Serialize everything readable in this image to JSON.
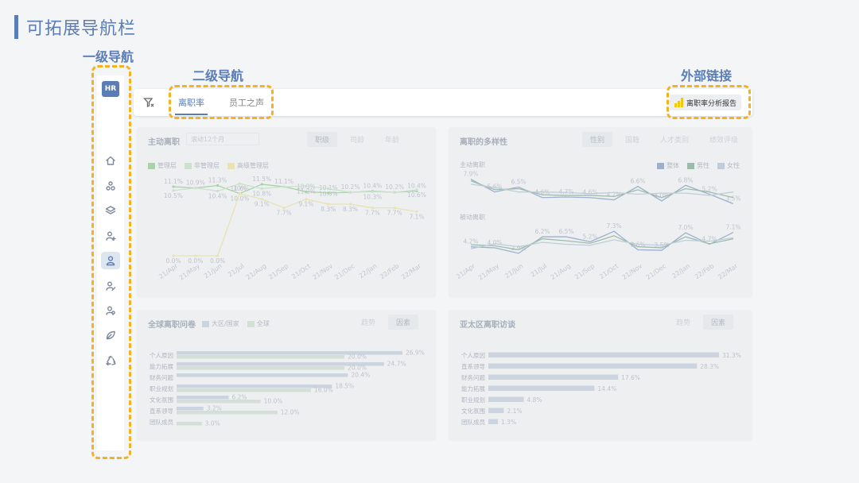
{
  "slide": {
    "title": "可拓展导航栏"
  },
  "annotations": {
    "primary_nav": "一级导航",
    "secondary_nav": "二级导航",
    "external_link": "外部链接"
  },
  "sidebar": {
    "badge": "HR",
    "items": [
      {
        "icon": "home-icon"
      },
      {
        "icon": "org-icon"
      },
      {
        "icon": "layers-icon"
      },
      {
        "icon": "user-add-icon"
      },
      {
        "icon": "user-icon",
        "active": true
      },
      {
        "icon": "user-edit-icon"
      },
      {
        "icon": "user-group-icon"
      },
      {
        "icon": "leaf-icon"
      },
      {
        "icon": "recycle-icon"
      }
    ]
  },
  "topbar": {
    "tabs": [
      {
        "label": "离职率",
        "active": true
      },
      {
        "label": "员工之声"
      }
    ],
    "report_link": "离职率分析报告"
  },
  "cards": {
    "voluntary": {
      "title": "主动离职",
      "dropdown": "滚动12个月",
      "tabs": [
        "职级",
        "司龄",
        "年龄"
      ],
      "legend": [
        "管理层",
        "非管理层",
        "高级管理层"
      ]
    },
    "diversity": {
      "title": "离职的多样性",
      "tabs": [
        "性别",
        "国籍",
        "人才类别",
        "绩效评级"
      ],
      "legend": [
        "整体",
        "男性",
        "女性"
      ],
      "sub1": "主动离职",
      "sub2": "被动离职"
    },
    "global_reasons": {
      "title": "全球离职问卷",
      "legend": [
        "大区/国家",
        "全球"
      ],
      "tabs": [
        "趋势",
        "因素"
      ]
    },
    "apac_reasons": {
      "title": "亚太区离职访谈",
      "tabs": [
        "趋势",
        "因素"
      ]
    }
  },
  "chart_data": [
    {
      "type": "line",
      "title": "主动离职",
      "x": [
        "21/Apr",
        "21/May",
        "21/Jun",
        "21/Jul",
        "21/Aug",
        "21/Sep",
        "21/Oct",
        "21/Nov",
        "21/Dec",
        "22/Jan",
        "22/Feb",
        "22/Mar"
      ],
      "series": [
        {
          "name": "管理层",
          "values": [
            11.1,
            10.9,
            11.3,
            10.0,
            11.5,
            11.1,
            10.3,
            10.1,
            10.2,
            10.4,
            10.2,
            10.4
          ],
          "labels": [
            "11.1%",
            "10.9%",
            "11.3%",
            "10%",
            "11.5%",
            "11.1%",
            "10.3%",
            "10.1%",
            "10.2%",
            "10.4%",
            "10.2%",
            "10.4%"
          ]
        },
        {
          "name": "非管理层",
          "values": [
            10.5,
            10.9,
            10.4,
            11.6,
            10.8,
            11.1,
            11.2,
            10.8,
            10.2,
            10.3,
            10.2,
            10.6
          ],
          "labels": [
            "10.5%",
            "",
            "10.4%",
            "11.6%",
            "10.8%",
            "",
            "11.2%",
            "10.8%",
            "",
            "10.3%",
            "",
            "10.6%"
          ]
        },
        {
          "name": "高级管理层",
          "values": [
            0.0,
            0.0,
            0.0,
            10.0,
            9.1,
            7.7,
            9.1,
            8.3,
            8.3,
            7.7,
            7.7,
            7.1
          ],
          "labels": [
            "0.0%",
            "0.0%",
            "0.0%",
            "10.0%",
            "9.1%",
            "7.7%",
            "9.1%",
            "8.3%",
            "8.3%",
            "7.7%",
            "7.7%",
            "7.1%"
          ]
        }
      ],
      "colors": [
        "#9ccc9c",
        "#c6dec6",
        "#e8dfa6"
      ],
      "ylim": [
        0,
        12
      ]
    },
    {
      "type": "line",
      "title": "主动离职",
      "x": [
        "21/Apr",
        "21/May",
        "21/Jun",
        "21/Jul",
        "21/Aug",
        "21/Sep",
        "21/Oct",
        "21/Nov",
        "21/Dec",
        "22/Jan",
        "22/Feb",
        "22/Mar"
      ],
      "series": [
        {
          "name": "整体",
          "values": [
            7.9,
            5.6,
            6.5,
            4.6,
            4.7,
            4.6,
            4.2,
            6.6,
            4.0,
            6.8,
            5.2,
            3.5
          ],
          "labels": [
            "7.9%",
            "5.6%",
            "6.5%",
            "4.6%",
            "4.7%",
            "4.6%",
            "4.2%",
            "6.6%",
            "4.0%",
            "6.8%",
            "5.2%",
            "3.5%"
          ]
        },
        {
          "name": "男性",
          "values": [
            7.6,
            6.0,
            6.2,
            5.1,
            5.0,
            5.0,
            4.8,
            6.0,
            4.6,
            6.2,
            5.6,
            4.6
          ]
        },
        {
          "name": "女性",
          "values": [
            7.0,
            6.4,
            5.6,
            5.6,
            5.5,
            5.3,
            5.5,
            5.2,
            5.4,
            5.4,
            5.0,
            5.6
          ]
        }
      ],
      "colors": [
        "#8ea4c6",
        "#8fb2a0",
        "#b7c7d5"
      ]
    },
    {
      "type": "line",
      "title": "被动离职",
      "x": [
        "21/Apr",
        "21/May",
        "21/Jun",
        "21/Jul",
        "21/Aug",
        "21/Sep",
        "21/Oct",
        "21/Nov",
        "21/Dec",
        "22/Jan",
        "22/Feb",
        "22/Mar"
      ],
      "series": [
        {
          "name": "整体",
          "values": [
            4.2,
            4.0,
            2.9,
            6.2,
            6.2,
            5.2,
            7.3,
            3.6,
            3.5,
            7.0,
            4.7,
            7.1
          ],
          "labels": [
            "4.2%",
            "4.0%",
            "2.9%",
            "6.2%",
            "6.5%",
            "5.2%",
            "7.3%",
            "3.6%",
            "3.5%",
            "7.0%",
            "4.7%",
            "7.1%"
          ]
        },
        {
          "name": "男性",
          "values": [
            4.6,
            4.4,
            3.6,
            5.8,
            5.4,
            4.9,
            6.4,
            4.2,
            4.0,
            6.2,
            4.8,
            5.8
          ]
        },
        {
          "name": "女性",
          "values": [
            3.8,
            4.8,
            4.2,
            5.1,
            4.7,
            4.5,
            5.6,
            4.7,
            4.5,
            5.5,
            5.3,
            6.0
          ]
        }
      ],
      "colors": [
        "#8ea4c6",
        "#8fb2a0",
        "#b7c7d5"
      ]
    },
    {
      "type": "bar",
      "title": "全球离职问卷",
      "categories": [
        "个人原因",
        "能力拓展",
        "财务问题",
        "职业规划",
        "文化氛围",
        "直系领导",
        "团队成员"
      ],
      "series": [
        {
          "name": "大区/国家",
          "values": [
            26.9,
            24.7,
            20.4,
            18.5,
            6.2,
            3.2,
            0
          ],
          "labels": [
            "26.9%",
            "24.7%",
            "20.4%",
            "18.5%",
            "6.2%",
            "3.2%",
            ""
          ]
        },
        {
          "name": "全球",
          "values": [
            20.0,
            20.0,
            0,
            16.0,
            10.0,
            12.0,
            3.0
          ],
          "labels": [
            "20.0%",
            "20.0%",
            "",
            "16.0%",
            "10.0%",
            "12.0%",
            "3.0%"
          ]
        }
      ],
      "colors": [
        "#c6cfdc",
        "#cfdcd3"
      ]
    },
    {
      "type": "bar",
      "title": "亚太区离职访谈",
      "categories": [
        "个人原因",
        "直系领导",
        "财务问题",
        "能力拓展",
        "职业规划",
        "文化氛围",
        "团队成员"
      ],
      "values": [
        31.3,
        28.3,
        17.6,
        14.4,
        4.8,
        2.1,
        1.3
      ],
      "labels": [
        "31.3%",
        "28.3%",
        "17.6%",
        "14.4%",
        "4.8%",
        "2.1%",
        "1.3%"
      ],
      "colors": [
        "#c6cfdc"
      ]
    }
  ]
}
